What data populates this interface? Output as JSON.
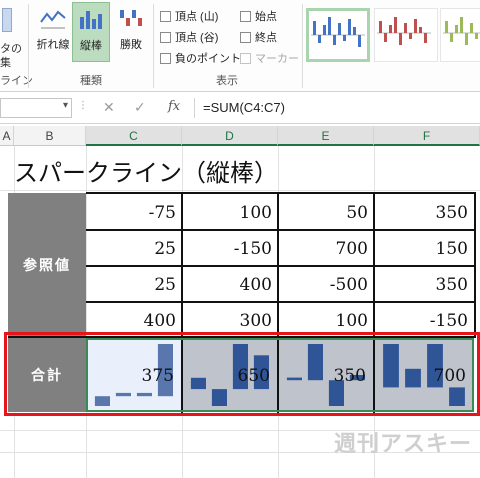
{
  "ribbon": {
    "left_cut_labels": [
      "タの",
      "集",
      "ライン"
    ],
    "type_buttons": [
      {
        "label": "折れ線",
        "icon": "line-sparkline-icon"
      },
      {
        "label": "縦棒",
        "icon": "column-sparkline-icon"
      },
      {
        "label": "勝敗",
        "icon": "win-loss-sparkline-icon"
      }
    ],
    "type_group_label": "種類",
    "show_options": [
      {
        "label": "頂点 (山)",
        "checked": false,
        "disabled": false
      },
      {
        "label": "始点",
        "checked": false,
        "disabled": false
      },
      {
        "label": "頂点 (谷)",
        "checked": false,
        "disabled": false
      },
      {
        "label": "終点",
        "checked": false,
        "disabled": false
      },
      {
        "label": "負のポイント",
        "checked": false,
        "disabled": false
      },
      {
        "label": "マーカー",
        "checked": false,
        "disabled": true
      }
    ],
    "show_group_label": "表示",
    "style_colors": [
      "#4472c4",
      "#c0504d",
      "#9bbb59"
    ]
  },
  "formula_bar": {
    "cancel_icon": "✕",
    "enter_icon": "✓",
    "fx_label": "fx",
    "formula": "=SUM(C4:C7)"
  },
  "columns": {
    "a": "A",
    "b": "B",
    "c": "C",
    "d": "D",
    "e": "E",
    "f": "F"
  },
  "sheet": {
    "title": "スパークライン（縦棒）",
    "ref_label": "参照値",
    "sum_label": "合計",
    "rows": [
      [
        "-75",
        "100",
        "50",
        "350"
      ],
      [
        "25",
        "-150",
        "700",
        "150"
      ],
      [
        "25",
        "400",
        "-500",
        "350"
      ],
      [
        "400",
        "300",
        "100",
        "-150"
      ]
    ],
    "sums": [
      "375",
      "650",
      "350",
      "700"
    ],
    "sparkline_color": "#2f5597",
    "sparkline_values": [
      [
        -75,
        25,
        25,
        400
      ],
      [
        100,
        -150,
        400,
        300
      ],
      [
        50,
        700,
        -500,
        100
      ],
      [
        350,
        150,
        350,
        -150
      ]
    ]
  },
  "watermark": "週刊アスキー"
}
